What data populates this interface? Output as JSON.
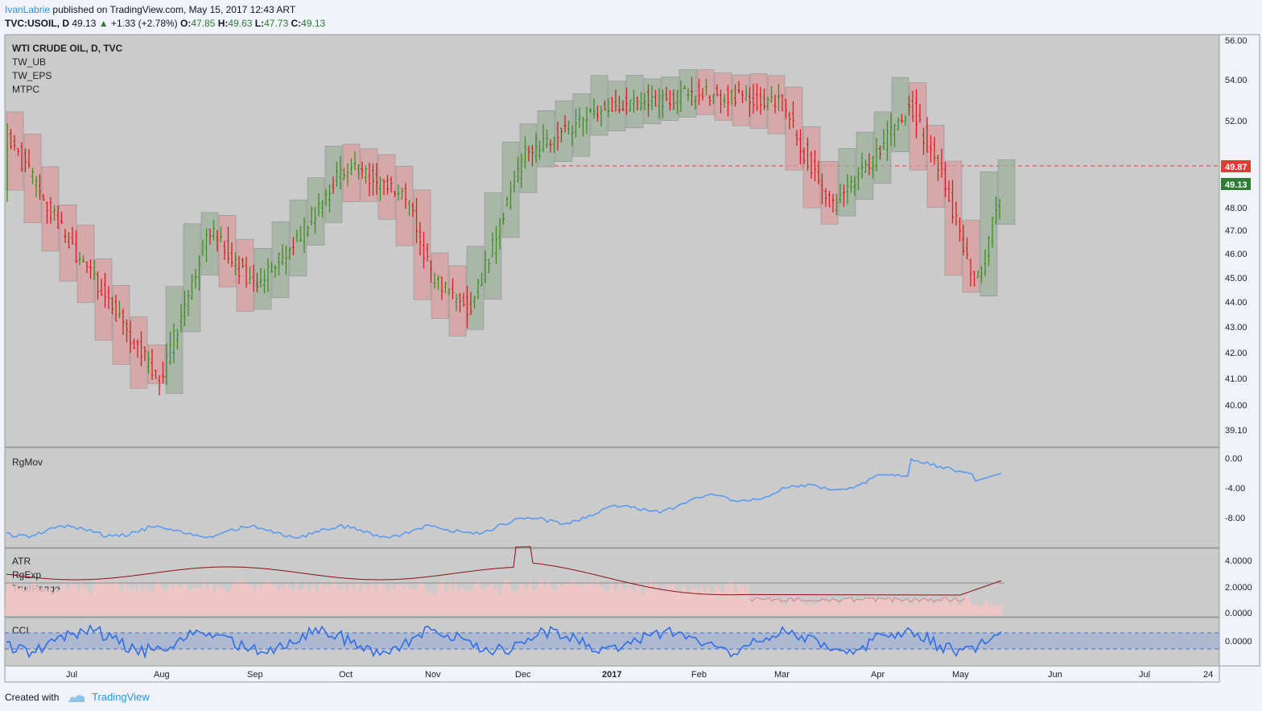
{
  "header": {
    "author": "IvanLabrie",
    "published_text": "published on TradingView.com, May 15, 2017 12:43 ART",
    "symbol": "TVC:USOIL, D",
    "last": "49.13",
    "change": "+1.33 (+2.78%)",
    "o_label": "O:",
    "o_value": "47.85",
    "h_label": "H:",
    "h_value": "49.63",
    "l_label": "L:",
    "l_value": "47.73",
    "c_label": "C:",
    "c_value": "49.13",
    "up_arrow": "▲"
  },
  "main_pane": {
    "title": "WTI CRUDE OIL, D, TVC",
    "indicators": [
      "TW_UB",
      "TW_EPS",
      "MTPC"
    ],
    "price_ticks": [
      "56.00",
      "54.00",
      "52.00",
      "48.00",
      "47.00",
      "46.00",
      "45.00",
      "44.00",
      "43.00",
      "42.00",
      "41.00",
      "40.00",
      "39.10"
    ],
    "hline_label": "49.87",
    "last_label": "49.13"
  },
  "pane2": {
    "title": "RgMov",
    "ticks": [
      "0.00",
      "-4.00",
      "-8.00"
    ]
  },
  "pane3": {
    "titles": [
      "ATR",
      "RgExp",
      "TrueRange"
    ],
    "ticks": [
      "4.0000",
      "2.0000",
      "0.0000"
    ]
  },
  "pane4": {
    "title": "CCI",
    "ticks": [
      "0.0000"
    ]
  },
  "time_axis": [
    "Jul",
    "Aug",
    "Sep",
    "Oct",
    "Nov",
    "Dec",
    "2017",
    "Feb",
    "Mar",
    "Apr",
    "May",
    "Jun",
    "Jul",
    "24"
  ],
  "footer": {
    "created_with": "Created with",
    "brand": "TradingView"
  },
  "colors": {
    "up": "#3f8f1f",
    "down": "#d42020",
    "pane_bg": "#cbcbcb",
    "hline": "#e53935",
    "blue": "#5b9bf0"
  },
  "chart_data": {
    "type": "ohlc",
    "symbol": "TVC:USOIL",
    "interval": "D",
    "last_close": 49.13,
    "reference_line": 49.87,
    "price_range": [
      38.9,
      56.2
    ],
    "anchors": [
      {
        "t": "Jun",
        "p": 51.5
      },
      {
        "t": "Jul",
        "p": 46.0
      },
      {
        "t": "Aug",
        "p": 39.5
      },
      {
        "t": "Aug-mid",
        "p": 47.0
      },
      {
        "t": "Sep",
        "p": 44.0
      },
      {
        "t": "Sep-mid",
        "p": 46.5
      },
      {
        "t": "Oct",
        "p": 50.0
      },
      {
        "t": "Oct-end",
        "p": 48.5
      },
      {
        "t": "Nov",
        "p": 44.5
      },
      {
        "t": "Nov-mid",
        "p": 43.0
      },
      {
        "t": "Dec",
        "p": 50.5
      },
      {
        "t": "2017",
        "p": 53.0
      },
      {
        "t": "Feb",
        "p": 53.5
      },
      {
        "t": "Mar",
        "p": 53.0
      },
      {
        "t": "Mar-mid",
        "p": 48.0
      },
      {
        "t": "Apr",
        "p": 50.5
      },
      {
        "t": "Apr-mid",
        "p": 53.0
      },
      {
        "t": "May",
        "p": 49.0
      },
      {
        "t": "May-mid",
        "p": 44.0
      },
      {
        "t": "May-15",
        "p": 49.13
      }
    ]
  }
}
